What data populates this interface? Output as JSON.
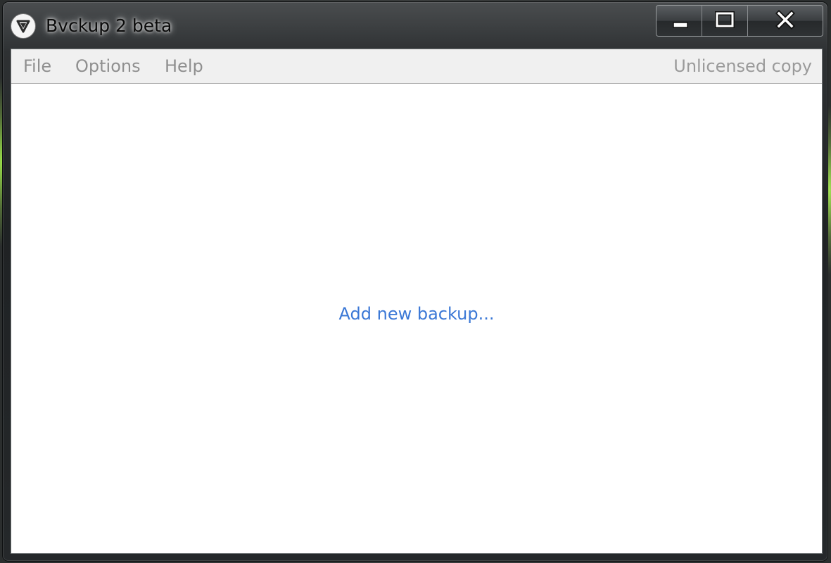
{
  "window": {
    "title": "Bvckup 2 beta",
    "app_icon": "bvckup-logo-icon",
    "caption_buttons": {
      "minimize_icon": "minimize-icon",
      "maximize_icon": "maximize-icon",
      "close_icon": "close-icon"
    }
  },
  "menubar": {
    "items": [
      {
        "label": "File"
      },
      {
        "label": "Options"
      },
      {
        "label": "Help"
      }
    ],
    "license_status": "Unlicensed copy"
  },
  "main": {
    "add_backup_link": "Add new backup..."
  },
  "colors": {
    "link": "#3b78d6",
    "menu_text": "#8f8f8f",
    "accent_green": "#9be04a"
  }
}
